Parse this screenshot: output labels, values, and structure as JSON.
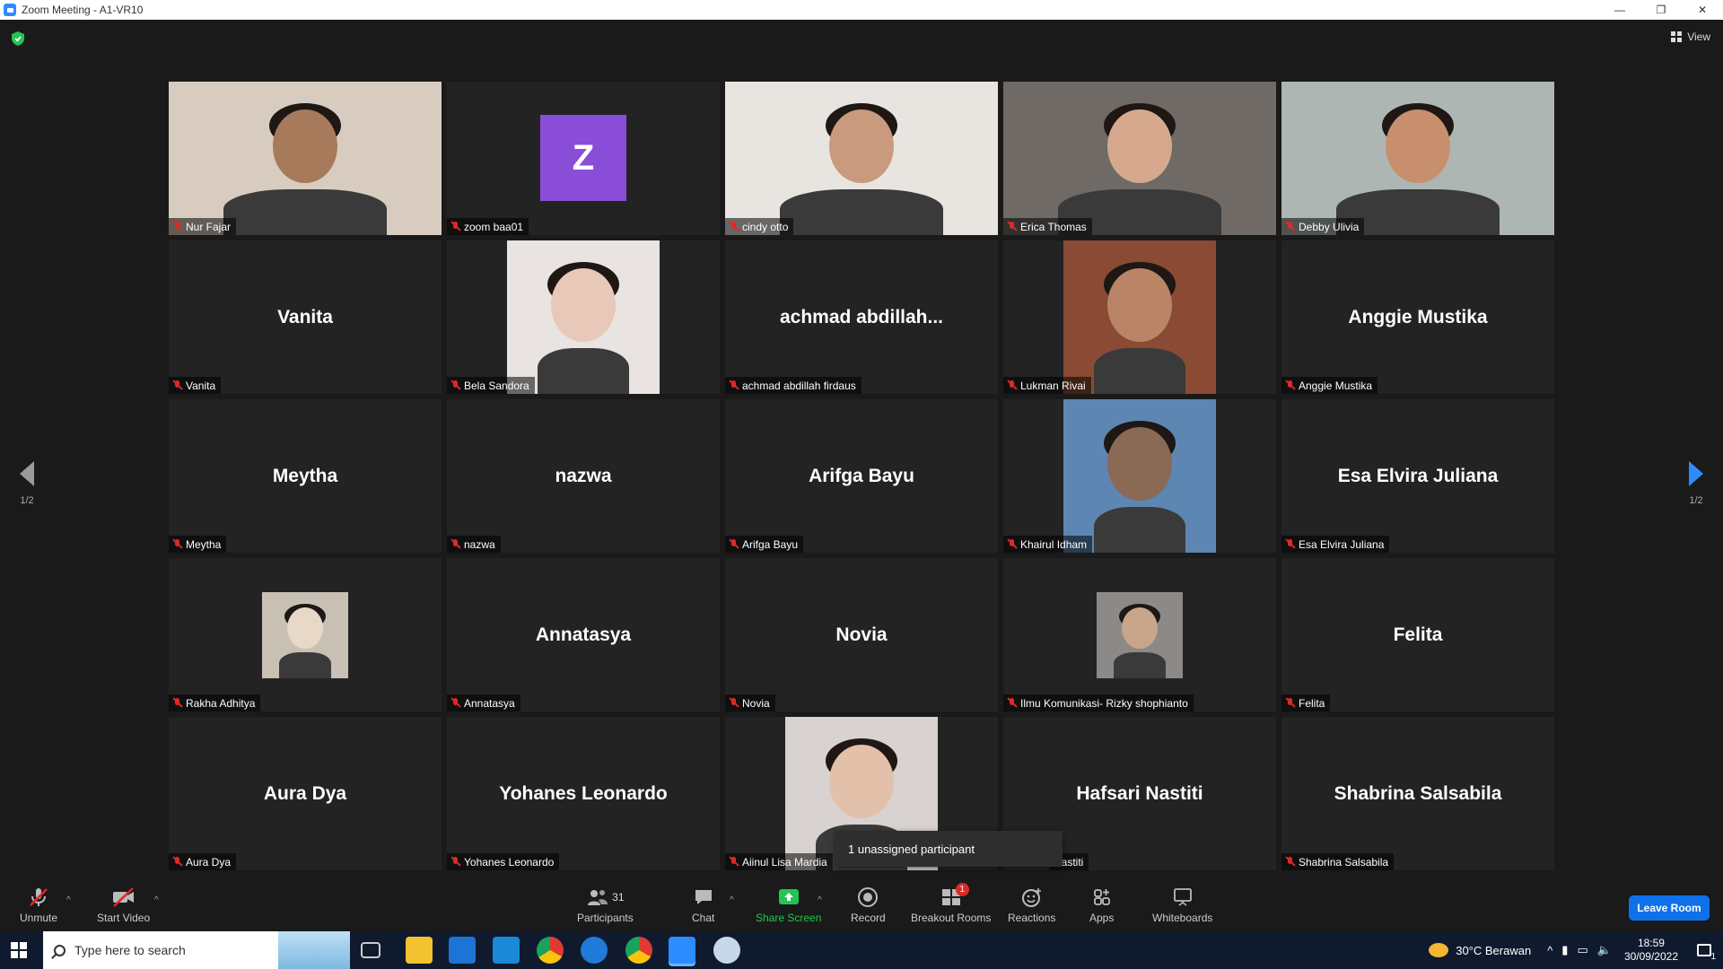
{
  "window": {
    "title": "Zoom Meeting - A1-VR10"
  },
  "header": {
    "view_label": "View"
  },
  "pagination": {
    "left": "1/2",
    "right": "1/2"
  },
  "participants": [
    {
      "tile_name": "Nur Fajar",
      "big_name": "",
      "kind": "video",
      "skin": "#a77a5c",
      "bg": "#d8ccc0"
    },
    {
      "tile_name": "zoom baa01",
      "big_name": "",
      "kind": "avatar",
      "initial": "Z",
      "avatar_color": "#8a4dd8"
    },
    {
      "tile_name": "cindy otto",
      "big_name": "",
      "kind": "video",
      "skin": "#c99a7e",
      "bg": "#e8e4e0"
    },
    {
      "tile_name": "Erica Thomas",
      "big_name": "",
      "kind": "video",
      "skin": "#d6a98e",
      "bg": "#6f6a66"
    },
    {
      "tile_name": "Debby Ulivia",
      "big_name": "",
      "kind": "video",
      "skin": "#c88f6e",
      "bg": "#aeb6b3"
    },
    {
      "tile_name": "Vanita",
      "big_name": "Vanita",
      "kind": "name"
    },
    {
      "tile_name": "Bela Sandora",
      "big_name": "",
      "kind": "photo",
      "skin": "#e8c8b8",
      "bg": "#e9e4e2"
    },
    {
      "tile_name": "achmad abdillah firdaus",
      "big_name": "achmad  abdillah...",
      "kind": "name"
    },
    {
      "tile_name": "Lukman Rivai",
      "big_name": "",
      "kind": "photo",
      "skin": "#b98566",
      "bg": "#8a4a34"
    },
    {
      "tile_name": "Anggie Mustika",
      "big_name": "Anggie Mustika",
      "kind": "name"
    },
    {
      "tile_name": "Meytha",
      "big_name": "Meytha",
      "kind": "name"
    },
    {
      "tile_name": "nazwa",
      "big_name": "nazwa",
      "kind": "name"
    },
    {
      "tile_name": "Arifga Bayu",
      "big_name": "Arifga Bayu",
      "kind": "name"
    },
    {
      "tile_name": "Khairul Idham",
      "big_name": "",
      "kind": "photo",
      "skin": "#8a6a55",
      "bg": "#5d86b3"
    },
    {
      "tile_name": "Esa Elvira Juliana",
      "big_name": "Esa Elvira Juliana",
      "kind": "name"
    },
    {
      "tile_name": "Rakha Adhitya",
      "big_name": "",
      "kind": "photo",
      "skin": "#e8d8c8",
      "bg": "#c9c0b4"
    },
    {
      "tile_name": "Annatasya",
      "big_name": "Annatasya",
      "kind": "name"
    },
    {
      "tile_name": "Novia",
      "big_name": "Novia",
      "kind": "name"
    },
    {
      "tile_name": "Ilmu Komunikasi- Rizky shophianto",
      "big_name": "",
      "kind": "photo",
      "skin": "#c9a58a",
      "bg": "#8c8a88"
    },
    {
      "tile_name": "Felita",
      "big_name": "Felita",
      "kind": "name"
    },
    {
      "tile_name": "Aura Dya",
      "big_name": "Aura Dya",
      "kind": "name"
    },
    {
      "tile_name": "Yohanes Leonardo",
      "big_name": "Yohanes Leonardo",
      "kind": "name"
    },
    {
      "tile_name": "Aiinul Lisa Mardia",
      "big_name": "",
      "kind": "photo",
      "skin": "#e3c0aa",
      "bg": "#d8d2d0"
    },
    {
      "tile_name": "Nastiti",
      "big_name": "Hafsari Nastiti",
      "kind": "name"
    },
    {
      "tile_name": "Shabrina Salsabila",
      "big_name": "Shabrina Salsabila",
      "kind": "name"
    }
  ],
  "tooltip": {
    "text": "1 unassigned participant"
  },
  "toolbar": {
    "unmute": "Unmute",
    "start_video": "Start Video",
    "participants": "Participants",
    "participants_count": "31",
    "chat": "Chat",
    "share_screen": "Share Screen",
    "record": "Record",
    "breakout_rooms": "Breakout Rooms",
    "breakout_badge": "1",
    "reactions": "Reactions",
    "apps": "Apps",
    "whiteboards": "Whiteboards",
    "leave_room": "Leave Room"
  },
  "taskbar": {
    "search_placeholder": "Type here to search",
    "weather": "30°C  Berawan",
    "time": "18:59",
    "date": "30/09/2022",
    "notification_count": "1"
  },
  "colors": {
    "accent": "#2d8cff",
    "leave": "#0e71eb",
    "muted_red": "#e02828",
    "share_green": "#23c552"
  }
}
